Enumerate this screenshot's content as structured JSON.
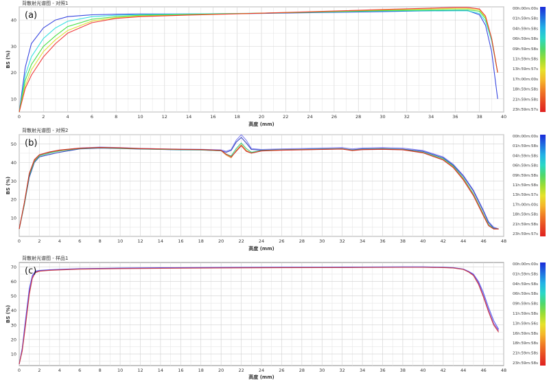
{
  "chart_data": [
    {
      "type": "line",
      "panel_label": "(a)",
      "title": "背散射光谱图 - 对照1",
      "xlabel": "高度 (mm)",
      "ylabel": "BS (%)",
      "xlim": [
        0,
        40
      ],
      "ylim": [
        5,
        45
      ],
      "x_ticks": [
        0,
        2,
        4,
        6,
        8,
        10,
        12,
        14,
        16,
        18,
        20,
        22,
        24,
        26,
        28,
        30,
        32,
        34,
        36,
        38,
        40
      ],
      "y_ticks": [
        10,
        20,
        30,
        40
      ],
      "grid": true,
      "legend_position": "right",
      "time_labels": [
        "00h:00m:00s",
        "01h:59m:58s",
        "04h:59m:58s",
        "06h:59m:58s",
        "09h:59m:58s",
        "11h:59m:58s",
        "13h:59m:57s",
        "17h:00m:00s",
        "18h:59m:58s",
        "21h:59m:58s",
        "23h:59m:57s"
      ],
      "series": [
        {
          "color": "#2233dd",
          "x": [
            0,
            0.5,
            1,
            2,
            3,
            4,
            6,
            8,
            10,
            14,
            20,
            26,
            30,
            34,
            36,
            37,
            38,
            38.5,
            39,
            39.5
          ],
          "y": [
            5,
            22,
            31,
            37,
            40,
            41.3,
            42,
            42.2,
            42.3,
            42.3,
            42.5,
            42.9,
            43.2,
            43.5,
            43.6,
            43.6,
            42,
            38,
            28,
            10
          ]
        },
        {
          "color": "#22dddd",
          "x": [
            0,
            0.5,
            1,
            2,
            3,
            4,
            6,
            8,
            10,
            14,
            20,
            26,
            30,
            34,
            36,
            37,
            38,
            38.5,
            39,
            39.5
          ],
          "y": [
            5,
            19,
            26,
            33,
            37,
            39.5,
            41.3,
            41.8,
            42.1,
            42.3,
            42.6,
            43.1,
            43.4,
            43.5,
            43.5,
            43.5,
            42.5,
            39.5,
            32,
            20
          ]
        },
        {
          "color": "#33dd33",
          "x": [
            0,
            0.5,
            1,
            2,
            3,
            4,
            6,
            8,
            10,
            14,
            20,
            26,
            30,
            34,
            36,
            37,
            38,
            38.5,
            39,
            39.5
          ],
          "y": [
            5,
            17,
            23,
            30,
            34,
            37.5,
            40.3,
            41.3,
            41.8,
            42.1,
            42.6,
            43.2,
            43.6,
            43.8,
            43.9,
            43.9,
            43.3,
            40.5,
            33,
            20
          ]
        },
        {
          "color": "#dddd22",
          "x": [
            0,
            0.5,
            1,
            2,
            3,
            4,
            6,
            8,
            10,
            14,
            20,
            26,
            30,
            34,
            36,
            37,
            38,
            38.5,
            39,
            39.5
          ],
          "y": [
            5,
            15,
            21,
            28,
            32.5,
            36,
            39.6,
            40.9,
            41.5,
            42,
            42.6,
            43.3,
            43.8,
            44.2,
            44.4,
            44.4,
            43.8,
            41,
            33,
            20
          ]
        },
        {
          "color": "#ee2222",
          "x": [
            0,
            0.5,
            1,
            2,
            3,
            4,
            6,
            8,
            10,
            14,
            20,
            26,
            30,
            34,
            36,
            37,
            38,
            38.5,
            39,
            39.5
          ],
          "y": [
            5,
            14,
            19,
            26,
            31,
            35,
            39,
            40.6,
            41.3,
            41.9,
            42.6,
            43.4,
            44,
            44.5,
            44.8,
            44.8,
            44.2,
            41.5,
            33,
            20
          ]
        }
      ]
    },
    {
      "type": "line",
      "panel_label": "(b)",
      "title": "背散射光谱图 - 对照2",
      "xlabel": "高度 (mm)",
      "ylabel": "BS (%)",
      "xlim": [
        0,
        48
      ],
      "ylim": [
        0,
        55
      ],
      "x_ticks": [
        0,
        2,
        4,
        6,
        8,
        10,
        12,
        14,
        16,
        18,
        20,
        22,
        24,
        26,
        28,
        30,
        32,
        34,
        36,
        38,
        40,
        42,
        44,
        46,
        48
      ],
      "y_ticks": [
        10,
        20,
        30,
        40,
        50
      ],
      "grid": true,
      "legend_position": "right",
      "time_labels": [
        "00h:00m:00s",
        "01h:59m:58s",
        "04h:59m:58s",
        "06h:59m:58s",
        "09h:59m:58s",
        "11h:59m:58s",
        "13h:59m:57s",
        "17h:00m:00s",
        "18h:59m:58s",
        "21h:59m:58s",
        "23h:59m:57s"
      ],
      "series": [
        {
          "color": "#7777ee",
          "x": [
            0,
            0.5,
            1,
            1.5,
            2,
            3,
            4,
            6,
            8,
            10,
            12,
            14,
            16,
            18,
            20,
            20.5,
            21,
            21.5,
            22,
            22.5,
            23,
            24,
            26,
            28,
            30,
            32,
            33,
            34,
            36,
            38,
            40,
            42,
            43,
            44,
            45,
            46,
            46.5,
            47,
            47.5
          ],
          "y": [
            4,
            18,
            33,
            41,
            44,
            45.3,
            46.5,
            47.8,
            48.3,
            48,
            47.6,
            47.3,
            47.2,
            47.1,
            46.8,
            46,
            47,
            52,
            55,
            52,
            47.5,
            47,
            47.3,
            47.5,
            47.8,
            48,
            47.3,
            47.8,
            48,
            47.7,
            46.5,
            43,
            39,
            33,
            25,
            14,
            8,
            5,
            4
          ]
        },
        {
          "color": "#2233bb",
          "x": [
            0,
            0.5,
            1,
            1.5,
            2,
            3,
            4,
            6,
            8,
            10,
            12,
            14,
            16,
            18,
            20,
            20.5,
            21,
            21.5,
            22,
            22.5,
            23,
            24,
            26,
            28,
            30,
            32,
            33,
            34,
            36,
            38,
            40,
            42,
            43,
            44,
            45,
            46,
            46.5,
            47,
            47.5
          ],
          "y": [
            4,
            17,
            32,
            40,
            43,
            44.3,
            45.5,
            47.3,
            47.7,
            47.5,
            47.2,
            47,
            46.8,
            46.7,
            46.3,
            45.5,
            46.5,
            51,
            53.5,
            50.5,
            47,
            46.6,
            46.9,
            47.1,
            47.3,
            47.5,
            46.8,
            47.3,
            47.5,
            47.2,
            46,
            42.5,
            38.5,
            32.5,
            24.5,
            13.5,
            7.5,
            4.5,
            4
          ]
        },
        {
          "color": "#22cc77",
          "x": [
            0,
            0.5,
            1,
            1.5,
            2,
            3,
            4,
            6,
            8,
            10,
            12,
            14,
            16,
            18,
            20,
            20.5,
            21,
            21.5,
            22,
            22.5,
            23,
            24,
            26,
            28,
            30,
            32,
            33,
            34,
            36,
            38,
            40,
            42,
            43,
            44,
            45,
            46,
            46.5,
            47,
            47.5
          ],
          "y": [
            4,
            17,
            33,
            40.5,
            43.5,
            45,
            46.2,
            47.5,
            47.9,
            47.6,
            47.3,
            47.1,
            46.9,
            46.8,
            46.3,
            44.5,
            43.5,
            47.5,
            50.5,
            47.5,
            45.5,
            46.4,
            46.8,
            47,
            47.2,
            47.4,
            46.6,
            47.1,
            47.3,
            47,
            45.5,
            42,
            38,
            31.5,
            23,
            12,
            6.5,
            4.2,
            4
          ]
        },
        {
          "color": "#dd8822",
          "x": [
            0,
            0.5,
            1,
            1.5,
            2,
            3,
            4,
            6,
            8,
            10,
            12,
            14,
            16,
            18,
            20,
            20.5,
            21,
            21.5,
            22,
            22.5,
            23,
            24,
            26,
            28,
            30,
            32,
            33,
            34,
            36,
            38,
            40,
            42,
            43,
            44,
            45,
            46,
            46.5,
            47,
            47.5
          ],
          "y": [
            4,
            18,
            34,
            41,
            44,
            45.5,
            46.5,
            47.6,
            48,
            47.8,
            47.4,
            47.2,
            47,
            46.9,
            46.4,
            44,
            42.5,
            46.5,
            49.5,
            46.5,
            45,
            46.3,
            46.7,
            46.9,
            47.1,
            47.3,
            46.5,
            47,
            47.2,
            46.9,
            45.3,
            41.5,
            37.5,
            31,
            22.5,
            11.5,
            6,
            4,
            4
          ]
        },
        {
          "color": "#cc2222",
          "x": [
            0,
            0.5,
            1,
            1.5,
            2,
            3,
            4,
            6,
            8,
            10,
            12,
            14,
            16,
            18,
            20,
            20.5,
            21,
            21.5,
            22,
            22.5,
            23,
            24,
            26,
            28,
            30,
            32,
            33,
            34,
            36,
            38,
            40,
            42,
            43,
            44,
            45,
            46,
            46.5,
            47,
            47.5
          ],
          "y": [
            4,
            18,
            34,
            41.5,
            44.2,
            45.7,
            46.7,
            47.7,
            48.1,
            47.9,
            47.5,
            47.3,
            47.1,
            47,
            46.5,
            44.5,
            43,
            46,
            49,
            46,
            45,
            46.2,
            46.6,
            46.8,
            47,
            47.2,
            46.4,
            46.9,
            47.1,
            46.8,
            45.2,
            41.3,
            37.2,
            30.5,
            22,
            11,
            5.8,
            4,
            4
          ]
        }
      ]
    },
    {
      "type": "line",
      "panel_label": "(c)",
      "title": "背散射光谱图 - 样品1",
      "xlabel": "高度 (mm)",
      "ylabel": "BS (%)",
      "xlim": [
        0,
        48
      ],
      "ylim": [
        2,
        73
      ],
      "x_ticks": [
        0,
        2,
        4,
        6,
        8,
        10,
        12,
        14,
        16,
        18,
        20,
        22,
        24,
        26,
        28,
        30,
        32,
        34,
        36,
        38,
        40,
        42,
        44,
        46,
        48
      ],
      "y_ticks": [
        10,
        20,
        30,
        40,
        50,
        60,
        70
      ],
      "grid": true,
      "legend_position": "right",
      "time_labels": [
        "00h:00m:00s",
        "01h:59m:58s",
        "04h:59m:58s",
        "06h:59m:58s",
        "09h:59m:58s",
        "11h:59m:58s",
        "13h:59m:56s",
        "16h:59m:58s",
        "18h:59m:58s",
        "21h:59m:58s",
        "23h:59m:58s"
      ],
      "series": [
        {
          "color": "#4455ee",
          "x": [
            0,
            0.3,
            0.6,
            1,
            1.3,
            1.6,
            2,
            3,
            4,
            6,
            8,
            10,
            14,
            20,
            26,
            30,
            34,
            38,
            40,
            42,
            43,
            44,
            44.5,
            45,
            45.5,
            46,
            46.5,
            47,
            47.5
          ],
          "y": [
            3,
            14,
            32,
            55,
            64,
            67,
            67.5,
            68,
            68.3,
            68.8,
            69,
            69.2,
            69.4,
            69.6,
            69.8,
            69.8,
            69.9,
            70,
            70,
            69.8,
            69.5,
            68.5,
            67,
            65,
            60,
            52,
            42,
            33,
            27
          ]
        },
        {
          "color": "#8833bb",
          "x": [
            0,
            0.3,
            0.6,
            1,
            1.3,
            1.6,
            2,
            3,
            4,
            6,
            8,
            10,
            14,
            20,
            26,
            30,
            34,
            38,
            40,
            42,
            43,
            44,
            44.5,
            45,
            45.5,
            46,
            46.5,
            47,
            47.5
          ],
          "y": [
            3,
            13,
            30,
            53,
            63,
            66.5,
            67.2,
            67.8,
            68.1,
            68.6,
            68.8,
            69,
            69.2,
            69.4,
            69.6,
            69.6,
            69.7,
            69.8,
            69.8,
            69.6,
            69.3,
            68.3,
            66.8,
            64.5,
            59,
            50,
            40,
            31,
            26
          ]
        },
        {
          "color": "#cc3333",
          "x": [
            0,
            0.3,
            0.6,
            1,
            1.3,
            1.6,
            2,
            3,
            4,
            6,
            8,
            10,
            14,
            20,
            26,
            30,
            34,
            38,
            40,
            42,
            43,
            44,
            44.5,
            45,
            45.5,
            46,
            46.5,
            47,
            47.5
          ],
          "y": [
            3,
            12,
            28,
            51,
            62,
            66,
            67,
            67.6,
            67.9,
            68.4,
            68.6,
            68.8,
            69,
            69.2,
            69.4,
            69.5,
            69.6,
            69.7,
            69.7,
            69.5,
            69.2,
            68.2,
            66.5,
            64,
            58,
            49,
            39,
            30,
            25
          ]
        }
      ]
    }
  ]
}
